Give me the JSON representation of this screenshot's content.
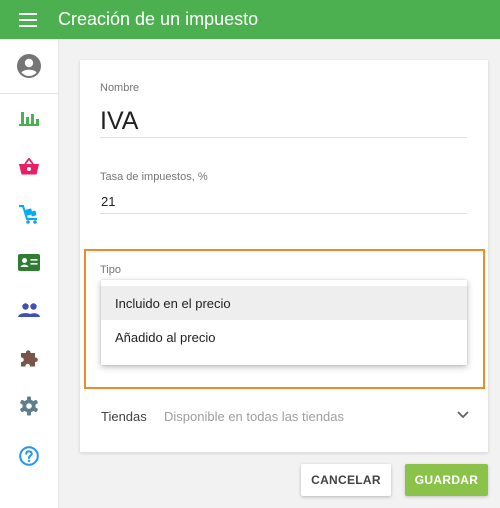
{
  "header": {
    "title": "Creación de un impuesto"
  },
  "form": {
    "name": {
      "label": "Nombre",
      "value": "IVA"
    },
    "rate": {
      "label": "Tasa de impuestos, %",
      "value": "21"
    },
    "type": {
      "label": "Tipo",
      "options": [
        "Incluido en el precio",
        "Añadido al precio"
      ],
      "highlighted": "Incluido en el precio"
    },
    "stores": {
      "label": "Tiendas",
      "value": "Disponible en todas las tiendas"
    }
  },
  "actions": {
    "cancel": "CANCELAR",
    "save": "GUARDAR"
  },
  "colors": {
    "appbar": "#4caf50",
    "save_button": "#8bc34a",
    "highlight_border": "#ec8a2e",
    "nav_reports": "#4caf50",
    "nav_items": "#e91e63",
    "nav_inventory": "#03a9f4",
    "nav_customers_card": "#2e7d32",
    "nav_employees": "#3f51b5",
    "nav_integrations": "#795548",
    "nav_settings": "#607d8b",
    "nav_help": "#2196f3"
  }
}
